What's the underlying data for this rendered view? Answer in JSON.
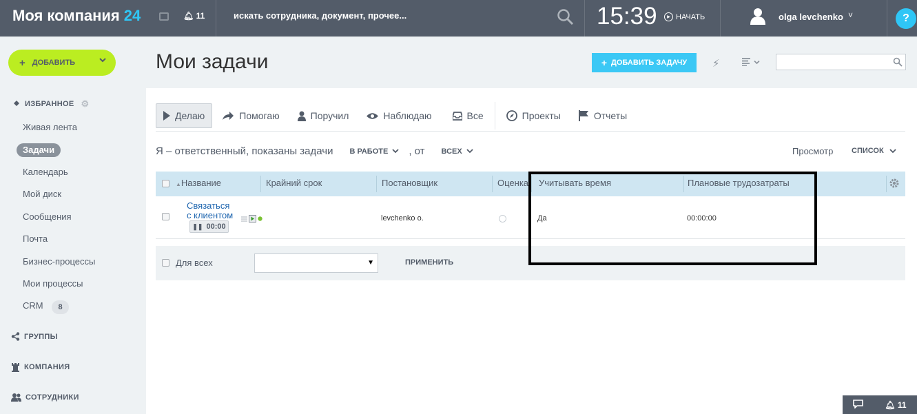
{
  "header": {
    "logo_text": "Моя компания",
    "logo_num": "24",
    "notif_count": "11",
    "search_placeholder": "искать сотрудника, документ, прочее...",
    "time": "15:39",
    "start_label": "НАЧАТЬ",
    "user_name": "olga levchenko",
    "help_label": "?"
  },
  "sidebar": {
    "add_label": "ДОБАВИТЬ",
    "favorites_label": "ИЗБРАННОЕ",
    "items": [
      {
        "label": "Живая лента"
      },
      {
        "label": "Задачи"
      },
      {
        "label": "Календарь"
      },
      {
        "label": "Мой диск"
      },
      {
        "label": "Сообщения"
      },
      {
        "label": "Почта"
      },
      {
        "label": "Бизнес-процессы"
      },
      {
        "label": "Мои процессы"
      },
      {
        "label": "CRM",
        "badge": "8"
      }
    ],
    "groups_label": "ГРУППЫ",
    "company_label": "КОМПАНИЯ",
    "employees_label": "СОТРУДНИКИ"
  },
  "page": {
    "title": "Мои задачи",
    "add_task_label": "ДОБАВИТЬ ЗАДАЧУ"
  },
  "tabs": [
    {
      "label": "Делаю",
      "icon": "play-icon"
    },
    {
      "label": "Помогаю",
      "icon": "arrow-icon"
    },
    {
      "label": "Поручил",
      "icon": "person-icon"
    },
    {
      "label": "Наблюдаю",
      "icon": "eye-icon"
    },
    {
      "label": "Все",
      "icon": "inbox-icon"
    },
    {
      "label": "Проекты",
      "icon": "compass-icon"
    },
    {
      "label": "Отчеты",
      "icon": "flag-icon"
    }
  ],
  "filter": {
    "prefix": "Я – ответственный, показаны задачи",
    "status": "В РАБОТЕ",
    "from": ", от",
    "who": "ВСЕХ",
    "view_label": "Просмотр",
    "view_value": "СПИСОК"
  },
  "table": {
    "columns": [
      "Название",
      "Крайний срок",
      "Постановщик",
      "Оценка",
      "Учитывать время",
      "Плановые трудозатраты"
    ],
    "rows": [
      {
        "title": "Связаться с клиентом",
        "timer": "00:00",
        "deadline": "",
        "creator": "levchenko o.",
        "track_time": "Да",
        "planned": "00:00:00"
      }
    ]
  },
  "footer": {
    "for_all_label": "Для всех",
    "apply_label": "ПРИМЕНИТЬ"
  },
  "bottom_bar": {
    "count": "11"
  },
  "colors": {
    "header_bg": "#535c69",
    "accent_green": "#bbed21",
    "accent_blue": "#3bc8f5",
    "table_head": "#cfe6f2"
  }
}
